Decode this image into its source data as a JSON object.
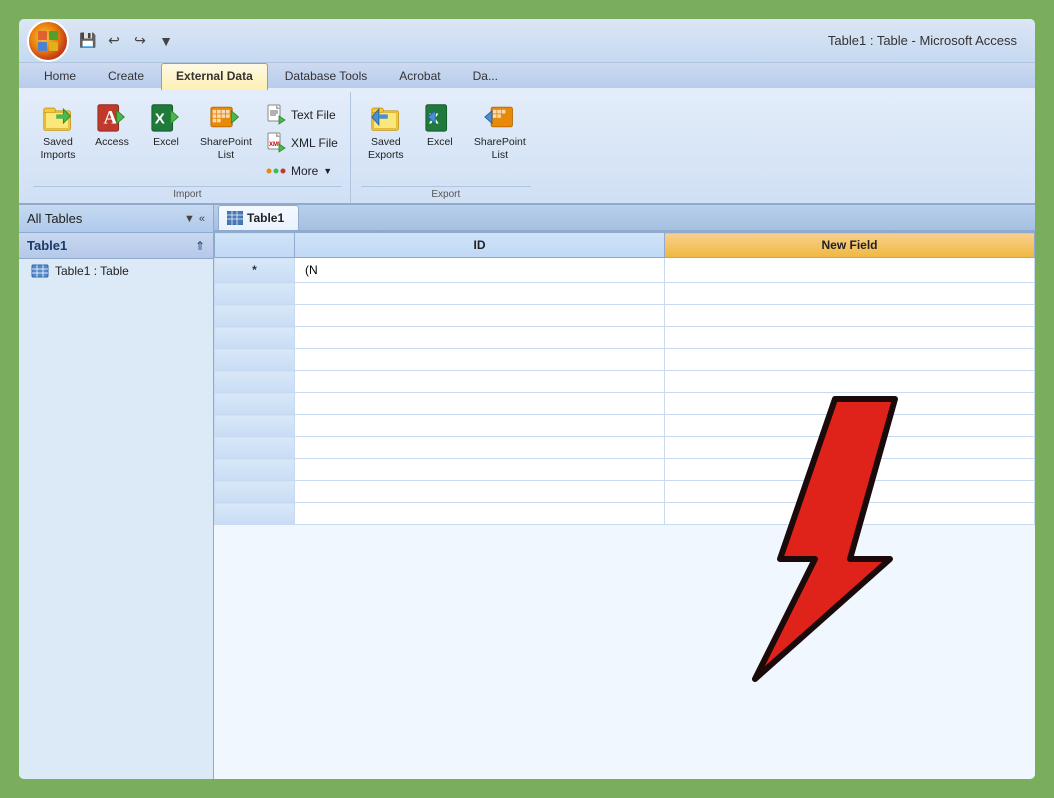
{
  "titleBar": {
    "title": "Table1 : Table - Microsoft Access"
  },
  "quickAccessToolbar": {
    "save": "💾",
    "undo": "↩",
    "redo": "↪",
    "customize": "▼"
  },
  "ribbonTabs": [
    {
      "id": "home",
      "label": "Home",
      "active": false
    },
    {
      "id": "create",
      "label": "Create",
      "active": false
    },
    {
      "id": "external-data",
      "label": "External Data",
      "active": true
    },
    {
      "id": "database-tools",
      "label": "Database Tools",
      "active": false
    },
    {
      "id": "acrobat",
      "label": "Acrobat",
      "active": false
    },
    {
      "id": "datasheet",
      "label": "Da...",
      "active": false
    }
  ],
  "importGroup": {
    "label": "Import",
    "items": [
      {
        "id": "saved-imports",
        "label": "Saved\nImports",
        "iconType": "folder-green-arrow"
      },
      {
        "id": "access",
        "label": "Access",
        "iconType": "key-arrow"
      },
      {
        "id": "excel",
        "label": "Excel",
        "iconType": "excel-arrow"
      },
      {
        "id": "sharepoint-list",
        "label": "SharePoint\nList",
        "iconType": "sp-arrow"
      }
    ],
    "smallItems": [
      {
        "id": "text-file",
        "label": "Text File",
        "iconType": "text-file"
      },
      {
        "id": "xml-file",
        "label": "XML File",
        "iconType": "xml-file"
      },
      {
        "id": "more",
        "label": "More",
        "iconType": "more-icon",
        "hasDropdown": true
      }
    ]
  },
  "exportGroup": {
    "label": "Export",
    "items": [
      {
        "id": "saved-exports",
        "label": "Saved\nExports",
        "iconType": "folder-blue-arrow"
      },
      {
        "id": "excel-export",
        "label": "Excel",
        "iconType": "excel-blue"
      },
      {
        "id": "sharepoint-list-export",
        "label": "SharePoint\nList",
        "iconType": "sp-blue"
      }
    ]
  },
  "navPane": {
    "title": "All Tables",
    "filterIcon": "▼",
    "collapseIcon": "«",
    "sections": [
      {
        "title": "Table1",
        "expanded": true,
        "items": [
          {
            "label": "Table1 : Table",
            "iconType": "table-icon"
          }
        ]
      }
    ]
  },
  "tableTab": {
    "label": "Table1",
    "iconType": "table-icon"
  },
  "tableData": {
    "columns": [
      "ID",
      "New Field"
    ],
    "rows": [
      {
        "rowHeader": "*",
        "id": "(N",
        "newField": ""
      }
    ]
  }
}
